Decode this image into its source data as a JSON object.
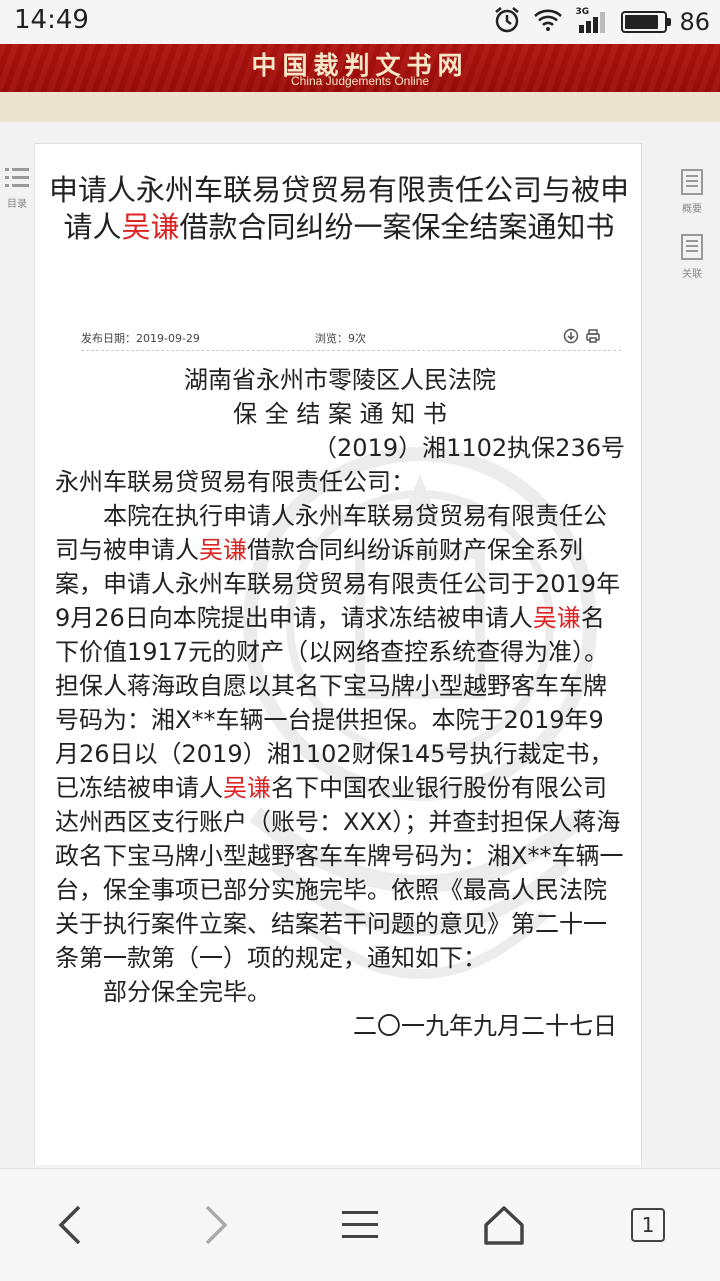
{
  "status_bar": {
    "time": "14:49",
    "network": "3G",
    "battery": "86",
    "battery_level": 0.86
  },
  "site": {
    "title_cn": "中国裁判文书网",
    "title_en": "China Judgements Online"
  },
  "rail": {
    "left_label": "目录",
    "right_summary_label": "概要",
    "right_related_label": "关联"
  },
  "document": {
    "title_pre": "申请人永州车联易贷贸易有限责任公司与被申请人",
    "title_name": "吴谦",
    "title_post": "借款合同纠纷一案保全结案通知书",
    "publish_date": "发布日期：2019-09-29",
    "views": "浏览：9次",
    "court": "湖南省永州市零陵区人民法院",
    "doc_type": "保 全 结 案 通 知 书",
    "case_no": "（2019）湘1102执保236号",
    "addressee": "永州车联易贷贸易有限责任公司：",
    "para1_a": "本院在执行申请人永州车联易贷贸易有限责任公司与被申请人",
    "name": "吴谦",
    "para1_b": "借款合同纠纷诉前财产保全系列案，申请人永州车联易贷贸易有限责任公司于2019年9月26日向本院提出申请，请求冻结被申请人",
    "para1_c": "名下价值1917元的财产（以网络查控系统查得为准）。担保人蒋海政自愿以其名下宝马牌小型越野客车车牌号码为：湘X**车辆一台提供担保。本院于2019年9月26日以（2019）湘1102财保145号执行裁定书，已冻结被申请人",
    "para1_d": "名下中国农业银行股份有限公司达州西区支行账户（账号：XXX）；并查封担保人蒋海政名下宝马牌小型越野客车车牌号码为：湘X**车辆一台，保全事项已部分实施完毕。依照《最高人民法院关于执行案件立案、结案若干问题的意见》第二十一条第一款第（一）项的规定，通知如下：",
    "para2": "部分保全完毕。",
    "date_signed": "二〇一九年九月二十七日"
  },
  "nav": {
    "tab_count": "1"
  }
}
